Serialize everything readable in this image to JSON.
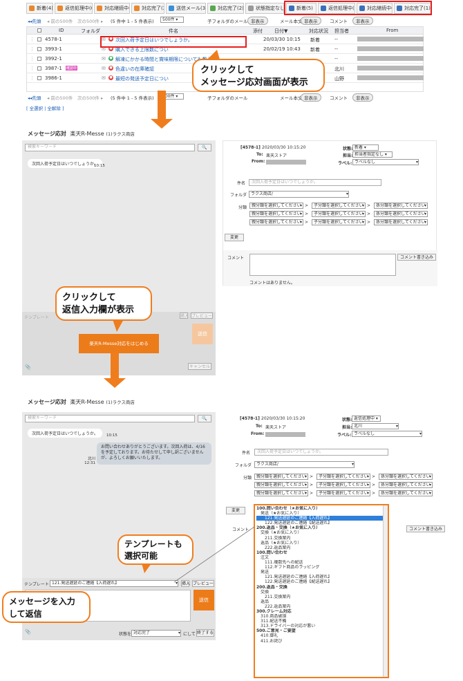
{
  "tabs": [
    "新着(4)",
    "返信処理中(0)",
    "対応継続中(3)",
    "対応完了(2)",
    "送信メール(3)",
    "対応完了(2)",
    "状態指定なし(29)",
    "新着(5)",
    "返信処理中(4)",
    "対応継続中(0)",
    "対応完了(1)"
  ],
  "pager": {
    "first": "先頭",
    "prev": "前の500件",
    "next": "次の500件",
    "count": "(5 件中 1 - 5 件表示)",
    "per": "500件",
    "sub": "子フォルダのメール",
    "body": "メール本文",
    "comment": "コメント",
    "hide": "非表示",
    "last": "先頭"
  },
  "columns": [
    "ID",
    "フォルダ",
    "件名",
    "添付",
    "日付▼",
    "対応状況",
    "担当者",
    "From"
  ],
  "rows": [
    {
      "id": "4578-1",
      "subject": "次回入荷予定日はいつでしょうか。",
      "date": "20/03/30 10:15",
      "status": "新着",
      "owner": "--"
    },
    {
      "id": "3993-1",
      "subject": "購入できる上限数につい",
      "date": "20/02/19 10:43",
      "status": "新着",
      "owner": "--"
    },
    {
      "id": "3992-1",
      "subject": "解凍にかかる時間と賞味期限についても教え",
      "date": "",
      "status": "",
      "owner": "--"
    },
    {
      "id": "3987-1",
      "subject": "色違いの在庫確認",
      "date": "",
      "status": "",
      "owner": "北川",
      "badge": "確認中"
    },
    {
      "id": "3986-1",
      "subject": "最短の発送予定日につい",
      "date": "",
      "status": "",
      "owner": "山野"
    }
  ],
  "select_links": "[ 全選択 | 全解除 ]",
  "callout1": [
    "クリックして",
    "メッセージ応対画面が表示"
  ],
  "callout2": [
    "クリックして",
    "返信入力欄が表示"
  ],
  "callout3": [
    "テンプレートも",
    "選択可能"
  ],
  "callout4": [
    "メッセージを入力",
    "して返信"
  ],
  "screen1": {
    "title": "メッセージ応対",
    "shop": "楽天R-Messe",
    "shop_sub": "(1)ラクス商店",
    "search": "検索キーワード",
    "msg": "次回入荷予定日はいつでしょうか。",
    "time": "10:15",
    "start": "楽天R-Messe対応をはじめる",
    "template": "テンプレート",
    "insert": "挿入",
    "preview": "プレビュー",
    "send": "送信",
    "cancel": "キャンセル"
  },
  "detail": {
    "id": "[4578-1]",
    "date": "2020/03/30 10:15:20",
    "to_l": "To:",
    "to": "楽天ストア",
    "from_l": "From:",
    "state_l": "状態:",
    "state": "新着",
    "owner_l": "担当:",
    "owner": "担当者指定なし",
    "label_l": "ラベル:",
    "label": "ラベルなし",
    "subject_l": "件名",
    "subject": "次回入荷予定日はいつでしょうか。",
    "folder_l": "フォルダ",
    "folder": "ラクス商店/",
    "cat_l": "分類",
    "cat1": "親分類を選択してください",
    "cat2": "子分類を選択してください",
    "cat3": "孫分類を選択してください",
    "change": "変更",
    "comment_l": "コメント",
    "comment_btn": "コメント書き込み",
    "no_comment": "コメントはありません。"
  },
  "screen2": {
    "reply": "お問い合わせありがとうございます。次回入荷は、4/16を予定しております。お待たせして申し訳ございませんが、よろしくお願いいたします。",
    "reply_user": "北川",
    "reply_time": "12:31",
    "state": "返信処理中",
    "owner": "北川",
    "template_value": "121.発送遅延のご連絡【入荷遅れ】",
    "status_l": "状態を",
    "status": "対応完了",
    "status_r": "にして",
    "finish": "終了する"
  },
  "dropdown": [
    "100.問い合わせ（★お気に入り）",
    "発送（★お気に入り）",
    "121.発送遅延のご連絡【入荷遅れ】",
    "122.発送遅延のご連絡【配送遅れ】",
    "200.返品・交換（★お気に入り）",
    "交換（★お気に入り）",
    "211.交換案内",
    "返品（★お気に入り）",
    "222.返品案内",
    "100.問い合わせ",
    "注文",
    "111.複数先への配送",
    "112.ギフト商品のラッピング",
    "発送",
    "121.発送遅延のご連絡【入荷遅れ】",
    "122.発送遅延のご連絡【配送遅れ】",
    "200.返品・交換",
    "交換",
    "211.交換案内",
    "返品",
    "222.返品案内",
    "300.クレーム対応",
    "310.商品破損",
    "311.配送不備",
    "313.ドライバーの対応が悪い",
    "500.ご意見・ご要望",
    "410.御礼",
    "411.お詫び"
  ]
}
